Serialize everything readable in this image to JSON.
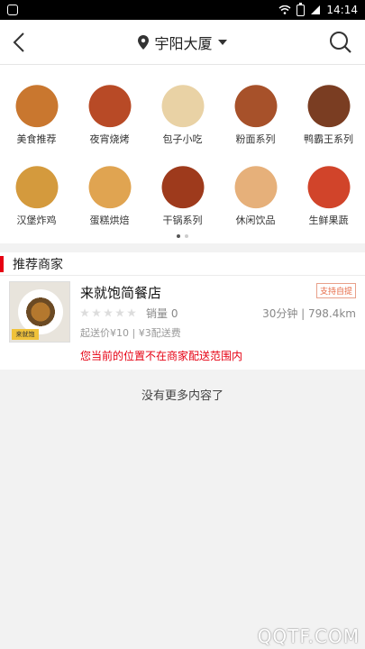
{
  "statusbar": {
    "time": "14:14"
  },
  "header": {
    "location": "宇阳大厦"
  },
  "categories": [
    {
      "label": "美食推荐",
      "icon": "fried-chicken-icon",
      "color": "#c9772f"
    },
    {
      "label": "夜宵烧烤",
      "icon": "bbq-skewer-icon",
      "color": "#b84a26"
    },
    {
      "label": "包子小吃",
      "icon": "steamed-bun-icon",
      "color": "#e9d2a5"
    },
    {
      "label": "粉面系列",
      "icon": "noodle-bowl-icon",
      "color": "#a7512a"
    },
    {
      "label": "鸭霸王系列",
      "icon": "braised-duck-icon",
      "color": "#7a3d22"
    },
    {
      "label": "汉堡炸鸡",
      "icon": "burger-icon",
      "color": "#d49a3d"
    },
    {
      "label": "蛋糕烘焙",
      "icon": "pizza-icon",
      "color": "#e0a451"
    },
    {
      "label": "干锅系列",
      "icon": "dry-pot-icon",
      "color": "#9e3a1c"
    },
    {
      "label": "休闲饮品",
      "icon": "drinks-icon",
      "color": "#e6b07a"
    },
    {
      "label": "生鲜果蔬",
      "icon": "fruit-basket-icon",
      "color": "#d1442a"
    }
  ],
  "section": {
    "title": "推荐商家"
  },
  "merchant": {
    "name": "来就饱简餐店",
    "badge": "支持自提",
    "rating": 0,
    "sales": "销量 0",
    "distance": "30分钟 | 798.4km",
    "fee": "起送价¥10 | ¥3配送费",
    "warning": "您当前的位置不在商家配送范围内",
    "thumb_brand": "来就饱"
  },
  "footer": {
    "no_more": "没有更多内容了"
  },
  "watermark": "QQTF.COM"
}
